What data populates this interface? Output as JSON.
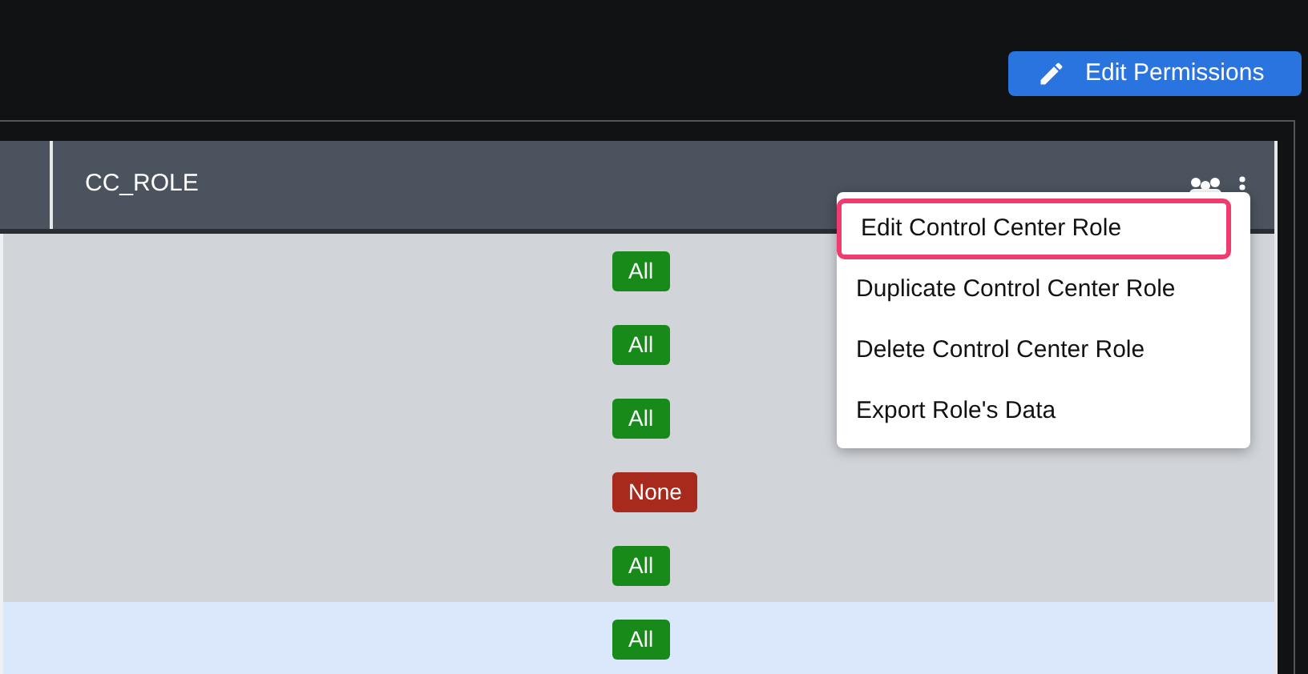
{
  "toolbar": {
    "edit_button": "Edit Permissions"
  },
  "table": {
    "columns": [
      "CC_ROLE"
    ],
    "rows": [
      {
        "value": "All",
        "kind": "all",
        "selected": false
      },
      {
        "value": "All",
        "kind": "all",
        "selected": false
      },
      {
        "value": "All",
        "kind": "all",
        "selected": false
      },
      {
        "value": "None",
        "kind": "none",
        "selected": false
      },
      {
        "value": "All",
        "kind": "all",
        "selected": false
      },
      {
        "value": "All",
        "kind": "all",
        "selected": true
      }
    ]
  },
  "menu": {
    "items": [
      {
        "label": "Edit Control Center Role",
        "highlighted": true
      },
      {
        "label": "Duplicate Control Center Role",
        "highlighted": false
      },
      {
        "label": "Delete Control Center Role",
        "highlighted": false
      },
      {
        "label": "Export Role's Data",
        "highlighted": false
      }
    ]
  }
}
